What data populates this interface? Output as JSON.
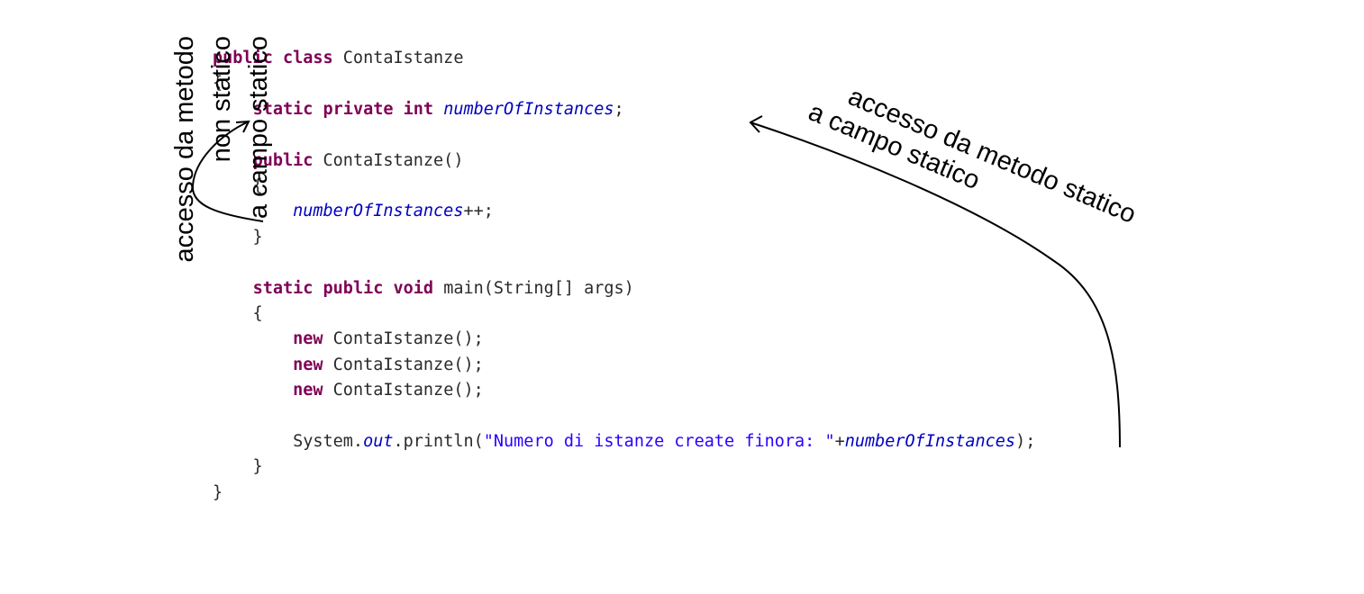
{
  "code": {
    "lines": [
      [
        {
          "t": "public class ",
          "k": "kw"
        },
        {
          "t": "ContaIstanze",
          "k": "plain"
        }
      ],
      [
        {
          "t": "{",
          "k": "plain"
        }
      ],
      [
        {
          "t": "    ",
          "k": "plain"
        },
        {
          "t": "static private int ",
          "k": "kw"
        },
        {
          "t": "numberOfInstances",
          "k": "field"
        },
        {
          "t": ";",
          "k": "plain"
        }
      ],
      [],
      [
        {
          "t": "    ",
          "k": "plain"
        },
        {
          "t": "public ",
          "k": "kw"
        },
        {
          "t": "ContaIstanze()",
          "k": "plain"
        }
      ],
      [
        {
          "t": "    {",
          "k": "plain"
        }
      ],
      [
        {
          "t": "        ",
          "k": "plain"
        },
        {
          "t": "numberOfInstances",
          "k": "field"
        },
        {
          "t": "++;",
          "k": "plain"
        }
      ],
      [
        {
          "t": "    }",
          "k": "plain"
        }
      ],
      [],
      [
        {
          "t": "    ",
          "k": "plain"
        },
        {
          "t": "static public void ",
          "k": "kw"
        },
        {
          "t": "main(String[] args)",
          "k": "plain"
        }
      ],
      [
        {
          "t": "    {",
          "k": "plain"
        }
      ],
      [
        {
          "t": "        ",
          "k": "plain"
        },
        {
          "t": "new ",
          "k": "kw"
        },
        {
          "t": "ContaIstanze();",
          "k": "plain"
        }
      ],
      [
        {
          "t": "        ",
          "k": "plain"
        },
        {
          "t": "new ",
          "k": "kw"
        },
        {
          "t": "ContaIstanze();",
          "k": "plain"
        }
      ],
      [
        {
          "t": "        ",
          "k": "plain"
        },
        {
          "t": "new ",
          "k": "kw"
        },
        {
          "t": "ContaIstanze();",
          "k": "plain"
        }
      ],
      [],
      [
        {
          "t": "        System.",
          "k": "plain"
        },
        {
          "t": "out",
          "k": "field"
        },
        {
          "t": ".println(",
          "k": "plain"
        },
        {
          "t": "\"Numero di istanze create finora: \"",
          "k": "str"
        },
        {
          "t": "+",
          "k": "plain"
        },
        {
          "t": "numberOfInstances",
          "k": "field"
        },
        {
          "t": ");",
          "k": "plain"
        }
      ],
      [
        {
          "t": "    }",
          "k": "plain"
        }
      ],
      [
        {
          "t": "}",
          "k": "plain"
        }
      ]
    ]
  },
  "annotations": {
    "left": {
      "line1": "accesso da metodo",
      "line2": "non statico",
      "line3": "a campo statico"
    },
    "right": {
      "line1": "accesso da metodo statico",
      "line2": "a campo statico"
    }
  },
  "colors": {
    "keyword": "#7f0055",
    "field": "#0000c0",
    "string": "#2a00ff",
    "text": "#2a2a2a",
    "annotation": "#000000"
  }
}
